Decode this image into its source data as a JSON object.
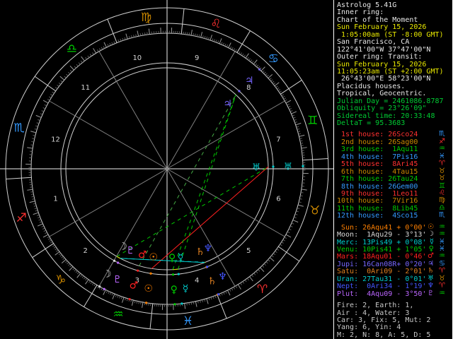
{
  "app": {
    "title": "Astrolog 5.41G"
  },
  "colors": {
    "text": {
      "white": "#e8e8e8",
      "yellow": "#e8e800",
      "green": "#00cc33",
      "gray": "#c8c8c8"
    },
    "elements": {
      "fire": "#ff3030",
      "earth": "#cc8800",
      "air": "#00cc00",
      "water": "#3399ff"
    },
    "objects": {
      "Sun": "#ff8000",
      "Moon": "#d8d8d8",
      "Mercury": "#00cccc",
      "Venus": "#00cc00",
      "Mars": "#ff2020",
      "Jupiter": "#7766ff",
      "Saturn": "#e08020",
      "Uranus": "#00cccc",
      "Neptune": "#4455ff",
      "Pluto": "#bb66ff"
    },
    "aspects": {
      "conjunction": "#dddd00",
      "square": "#ff2020",
      "trine": "#00cc00",
      "sextile": "#00cccc",
      "quincunx": "#44aa44"
    },
    "wheel": {
      "ring": "#d0d0d0",
      "axis": "#f0f0f0",
      "spoke": "#808080",
      "tick5": "#999999",
      "tick1": "#5f5f5f",
      "house_number": "#d4d4d4"
    }
  },
  "sidebar": {
    "header": [
      {
        "text": "Astrolog 5.41G",
        "color": "white"
      },
      {
        "text": "Inner ring:",
        "color": "white"
      },
      {
        "text": "Chart of the Moment",
        "color": "white"
      },
      {
        "text": "Sun February 15, 2026",
        "color": "yellow"
      },
      {
        "text": " 1:05:00am (ST -8:00 GMT)",
        "color": "yellow"
      },
      {
        "text": "San Francisco, CA",
        "color": "white"
      },
      {
        "text": "122°41'00\"W 37°47'00\"N",
        "color": "white"
      },
      {
        "text": "Outer ring: Transit:",
        "color": "white"
      },
      {
        "text": "Sun February 15, 2026",
        "color": "yellow"
      },
      {
        "text": "11:05:23am (ST +2:00 GMT)",
        "color": "yellow"
      },
      {
        "text": " 26°43'00\"E 58°23'00\"N",
        "color": "white"
      },
      {
        "text": "Placidus houses.",
        "color": "white"
      },
      {
        "text": "Tropical, Geocentric.",
        "color": "white"
      },
      {
        "text": "Julian Day = 2461086.8787",
        "color": "green"
      },
      {
        "text": "Obliquity = 23°26'09\"",
        "color": "green"
      },
      {
        "text": "Sidereal time: 20:33:48",
        "color": "green"
      },
      {
        "text": "DeltaT = 95.3683",
        "color": "green"
      }
    ],
    "houses": [
      {
        "text": " 1st house: 26Sco24",
        "sign": "Sco"
      },
      {
        "text": " 2nd house: 26Sag00",
        "sign": "Sag"
      },
      {
        "text": " 3rd house:  1Aqu11",
        "sign": "Aqu"
      },
      {
        "text": " 4th house:  7Pis16",
        "sign": "Pis"
      },
      {
        "text": " 5th house:  8Ari45",
        "sign": "Ari"
      },
      {
        "text": " 6th house:  4Tau15",
        "sign": "Tau"
      },
      {
        "text": " 7th house: 26Tau24",
        "sign": "Tau"
      },
      {
        "text": " 8th house: 26Gem00",
        "sign": "Gem"
      },
      {
        "text": " 9th house:  1Leo11",
        "sign": "Leo"
      },
      {
        "text": "10th house:  7Vir16",
        "sign": "Vir"
      },
      {
        "text": "11th house:  8Lib45",
        "sign": "Lib"
      },
      {
        "text": "12th house:  4Sco15",
        "sign": "Sco"
      }
    ],
    "planets": [
      {
        "name": "Sun",
        "text": " Sun: 26Aqu41 + 0°00'",
        "sign": "Aqu"
      },
      {
        "name": "Moon",
        "text": "Moon:  1Aqu29 - 3°13'",
        "sign": "Aqu"
      },
      {
        "name": "Mercury",
        "text": "Merc: 13Pis49 + 0°08'",
        "sign": "Pis"
      },
      {
        "name": "Venus",
        "text": "Venu: 10Pis41 + 1°05'",
        "sign": "Pis"
      },
      {
        "name": "Mars",
        "text": "Mars: 18Aqu01 - 0°46'",
        "sign": "Aqu"
      },
      {
        "name": "Jupiter",
        "text": "Jupi: 16Can08R+ 0°20'",
        "sign": "Can"
      },
      {
        "name": "Saturn",
        "text": "Satu:  0Ari09 - 2°01'",
        "sign": "Ari"
      },
      {
        "name": "Uranus",
        "text": "Uran: 27Tau31 - 0°01'",
        "sign": "Tau"
      },
      {
        "name": "Neptune",
        "text": "Nept:  0Ari34 - 1°19'",
        "sign": "Ari"
      },
      {
        "name": "Pluto",
        "text": "Plut:  4Aqu09 - 3°50'",
        "sign": "Aqu"
      }
    ],
    "tallies": [
      {
        "text": "Fire: 2, Earth: 1,"
      },
      {
        "text": "Air : 4, Water: 3"
      },
      {
        "text": "Car: 3, Fix: 5, Mut: 2"
      },
      {
        "text": "Yang: 6, Yin: 4"
      },
      {
        "text": "M: 2, N: 8, A: 5, D: 5"
      }
    ]
  },
  "chart_data": {
    "type": "astrology-biwheel",
    "description": "Astrolog wheel chart, 12 equal house sectors, inner natal ring and outer transit ring of the same moment",
    "signs": [
      "Ari",
      "Tau",
      "Gem",
      "Can",
      "Leo",
      "Vir",
      "Lib",
      "Sco",
      "Sag",
      "Cap",
      "Aqu",
      "Pis"
    ],
    "sign_glyphs": {
      "Ari": "♈",
      "Tau": "♉",
      "Gem": "♊",
      "Can": "♋",
      "Leo": "♌",
      "Vir": "♍",
      "Lib": "♎",
      "Sco": "♏",
      "Sag": "♐",
      "Cap": "♑",
      "Aqu": "♒",
      "Pis": "♓"
    },
    "house_cusps": [
      "26Sco24",
      "26Sag00",
      "1Aqu11",
      "7Pis16",
      "8Ari45",
      "4Tau15",
      "26Tau24",
      "26Gem00",
      "1Leo11",
      "7Vir16",
      "8Lib45",
      "4Sco15"
    ],
    "planets": [
      {
        "name": "Sun",
        "glyph": "☉",
        "pos": "26Aqu41"
      },
      {
        "name": "Moon",
        "glyph": "☽",
        "pos": "1Aqu29"
      },
      {
        "name": "Mercury",
        "glyph": "☿",
        "pos": "13Pis49"
      },
      {
        "name": "Venus",
        "glyph": "♀",
        "pos": "10Pis41"
      },
      {
        "name": "Mars",
        "glyph": "♂",
        "pos": "18Aqu01"
      },
      {
        "name": "Jupiter",
        "glyph": "♃",
        "pos": "16Can08"
      },
      {
        "name": "Saturn",
        "glyph": "♄",
        "pos": "0Ari09"
      },
      {
        "name": "Uranus",
        "glyph": "♅",
        "pos": "27Tau31"
      },
      {
        "name": "Neptune",
        "glyph": "♆",
        "pos": "0Ari34"
      },
      {
        "name": "Pluto",
        "glyph": "♇",
        "pos": "4Aqu09"
      }
    ],
    "outer_ring_same_as_inner": true,
    "aspects": [
      {
        "p1": "Sun",
        "p2": "Uranus",
        "aspect": "square",
        "style": "solid"
      },
      {
        "p1": "Moon",
        "p2": "Uranus",
        "aspect": "trine",
        "style": "dashed"
      },
      {
        "p1": "Mercury",
        "p2": "Jupiter",
        "aspect": "trine",
        "style": "dashed"
      },
      {
        "p1": "Venus",
        "p2": "Jupiter",
        "aspect": "trine",
        "style": "dashed"
      },
      {
        "p1": "Mars",
        "p2": "Jupiter",
        "aspect": "quincunx",
        "style": "dashed"
      },
      {
        "p1": "Saturn",
        "p2": "Pluto",
        "aspect": "sextile",
        "style": "solid"
      },
      {
        "p1": "Neptune",
        "p2": "Pluto",
        "aspect": "sextile",
        "style": "dashed"
      },
      {
        "p1": "Venus",
        "p2": "Mercury",
        "aspect": "conjunction",
        "style": "solid"
      },
      {
        "p1": "Moon",
        "p2": "Pluto",
        "aspect": "conjunction",
        "style": "solid"
      },
      {
        "p1": "Saturn",
        "p2": "Neptune",
        "aspect": "conjunction",
        "style": "solid"
      }
    ]
  }
}
